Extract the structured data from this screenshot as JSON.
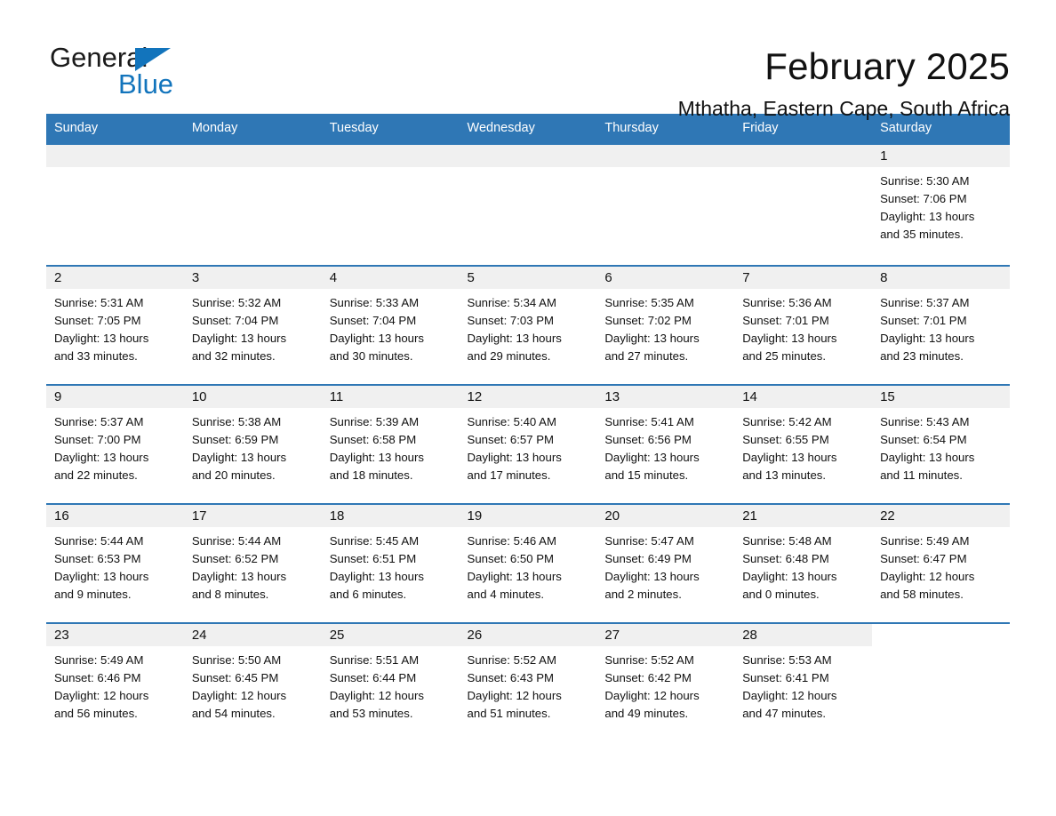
{
  "logo": {
    "word_one": "General",
    "word_two": "Blue",
    "triangle_color": "#1274bc",
    "blue_color": "#1274bc",
    "general_color": "#1a1a1a"
  },
  "header": {
    "month_title": "February 2025",
    "location": "Mthatha, Eastern Cape, South Africa"
  },
  "theme": {
    "header_blue": "#2f77b5",
    "row_divider_blue": "#2f77b5",
    "daynum_band": "#f0f0f0",
    "text": "#111111"
  },
  "weekday_headers": [
    "Sunday",
    "Monday",
    "Tuesday",
    "Wednesday",
    "Thursday",
    "Friday",
    "Saturday"
  ],
  "weeks": [
    [
      {
        "day": "",
        "empty": true
      },
      {
        "day": "",
        "empty": true
      },
      {
        "day": "",
        "empty": true
      },
      {
        "day": "",
        "empty": true
      },
      {
        "day": "",
        "empty": true
      },
      {
        "day": "",
        "empty": true
      },
      {
        "day": "1",
        "sunrise": "Sunrise: 5:30 AM",
        "sunset": "Sunset: 7:06 PM",
        "daylight_line1": "Daylight: 13 hours",
        "daylight_line2": "and 35 minutes."
      }
    ],
    [
      {
        "day": "2",
        "sunrise": "Sunrise: 5:31 AM",
        "sunset": "Sunset: 7:05 PM",
        "daylight_line1": "Daylight: 13 hours",
        "daylight_line2": "and 33 minutes."
      },
      {
        "day": "3",
        "sunrise": "Sunrise: 5:32 AM",
        "sunset": "Sunset: 7:04 PM",
        "daylight_line1": "Daylight: 13 hours",
        "daylight_line2": "and 32 minutes."
      },
      {
        "day": "4",
        "sunrise": "Sunrise: 5:33 AM",
        "sunset": "Sunset: 7:04 PM",
        "daylight_line1": "Daylight: 13 hours",
        "daylight_line2": "and 30 minutes."
      },
      {
        "day": "5",
        "sunrise": "Sunrise: 5:34 AM",
        "sunset": "Sunset: 7:03 PM",
        "daylight_line1": "Daylight: 13 hours",
        "daylight_line2": "and 29 minutes."
      },
      {
        "day": "6",
        "sunrise": "Sunrise: 5:35 AM",
        "sunset": "Sunset: 7:02 PM",
        "daylight_line1": "Daylight: 13 hours",
        "daylight_line2": "and 27 minutes."
      },
      {
        "day": "7",
        "sunrise": "Sunrise: 5:36 AM",
        "sunset": "Sunset: 7:01 PM",
        "daylight_line1": "Daylight: 13 hours",
        "daylight_line2": "and 25 minutes."
      },
      {
        "day": "8",
        "sunrise": "Sunrise: 5:37 AM",
        "sunset": "Sunset: 7:01 PM",
        "daylight_line1": "Daylight: 13 hours",
        "daylight_line2": "and 23 minutes."
      }
    ],
    [
      {
        "day": "9",
        "sunrise": "Sunrise: 5:37 AM",
        "sunset": "Sunset: 7:00 PM",
        "daylight_line1": "Daylight: 13 hours",
        "daylight_line2": "and 22 minutes."
      },
      {
        "day": "10",
        "sunrise": "Sunrise: 5:38 AM",
        "sunset": "Sunset: 6:59 PM",
        "daylight_line1": "Daylight: 13 hours",
        "daylight_line2": "and 20 minutes."
      },
      {
        "day": "11",
        "sunrise": "Sunrise: 5:39 AM",
        "sunset": "Sunset: 6:58 PM",
        "daylight_line1": "Daylight: 13 hours",
        "daylight_line2": "and 18 minutes."
      },
      {
        "day": "12",
        "sunrise": "Sunrise: 5:40 AM",
        "sunset": "Sunset: 6:57 PM",
        "daylight_line1": "Daylight: 13 hours",
        "daylight_line2": "and 17 minutes."
      },
      {
        "day": "13",
        "sunrise": "Sunrise: 5:41 AM",
        "sunset": "Sunset: 6:56 PM",
        "daylight_line1": "Daylight: 13 hours",
        "daylight_line2": "and 15 minutes."
      },
      {
        "day": "14",
        "sunrise": "Sunrise: 5:42 AM",
        "sunset": "Sunset: 6:55 PM",
        "daylight_line1": "Daylight: 13 hours",
        "daylight_line2": "and 13 minutes."
      },
      {
        "day": "15",
        "sunrise": "Sunrise: 5:43 AM",
        "sunset": "Sunset: 6:54 PM",
        "daylight_line1": "Daylight: 13 hours",
        "daylight_line2": "and 11 minutes."
      }
    ],
    [
      {
        "day": "16",
        "sunrise": "Sunrise: 5:44 AM",
        "sunset": "Sunset: 6:53 PM",
        "daylight_line1": "Daylight: 13 hours",
        "daylight_line2": "and 9 minutes."
      },
      {
        "day": "17",
        "sunrise": "Sunrise: 5:44 AM",
        "sunset": "Sunset: 6:52 PM",
        "daylight_line1": "Daylight: 13 hours",
        "daylight_line2": "and 8 minutes."
      },
      {
        "day": "18",
        "sunrise": "Sunrise: 5:45 AM",
        "sunset": "Sunset: 6:51 PM",
        "daylight_line1": "Daylight: 13 hours",
        "daylight_line2": "and 6 minutes."
      },
      {
        "day": "19",
        "sunrise": "Sunrise: 5:46 AM",
        "sunset": "Sunset: 6:50 PM",
        "daylight_line1": "Daylight: 13 hours",
        "daylight_line2": "and 4 minutes."
      },
      {
        "day": "20",
        "sunrise": "Sunrise: 5:47 AM",
        "sunset": "Sunset: 6:49 PM",
        "daylight_line1": "Daylight: 13 hours",
        "daylight_line2": "and 2 minutes."
      },
      {
        "day": "21",
        "sunrise": "Sunrise: 5:48 AM",
        "sunset": "Sunset: 6:48 PM",
        "daylight_line1": "Daylight: 13 hours",
        "daylight_line2": "and 0 minutes."
      },
      {
        "day": "22",
        "sunrise": "Sunrise: 5:49 AM",
        "sunset": "Sunset: 6:47 PM",
        "daylight_line1": "Daylight: 12 hours",
        "daylight_line2": "and 58 minutes."
      }
    ],
    [
      {
        "day": "23",
        "sunrise": "Sunrise: 5:49 AM",
        "sunset": "Sunset: 6:46 PM",
        "daylight_line1": "Daylight: 12 hours",
        "daylight_line2": "and 56 minutes."
      },
      {
        "day": "24",
        "sunrise": "Sunrise: 5:50 AM",
        "sunset": "Sunset: 6:45 PM",
        "daylight_line1": "Daylight: 12 hours",
        "daylight_line2": "and 54 minutes."
      },
      {
        "day": "25",
        "sunrise": "Sunrise: 5:51 AM",
        "sunset": "Sunset: 6:44 PM",
        "daylight_line1": "Daylight: 12 hours",
        "daylight_line2": "and 53 minutes."
      },
      {
        "day": "26",
        "sunrise": "Sunrise: 5:52 AM",
        "sunset": "Sunset: 6:43 PM",
        "daylight_line1": "Daylight: 12 hours",
        "daylight_line2": "and 51 minutes."
      },
      {
        "day": "27",
        "sunrise": "Sunrise: 5:52 AM",
        "sunset": "Sunset: 6:42 PM",
        "daylight_line1": "Daylight: 12 hours",
        "daylight_line2": "and 49 minutes."
      },
      {
        "day": "28",
        "sunrise": "Sunrise: 5:53 AM",
        "sunset": "Sunset: 6:41 PM",
        "daylight_line1": "Daylight: 12 hours",
        "daylight_line2": "and 47 minutes."
      },
      {
        "day": "",
        "empty": true,
        "blank_tail": true
      }
    ]
  ]
}
